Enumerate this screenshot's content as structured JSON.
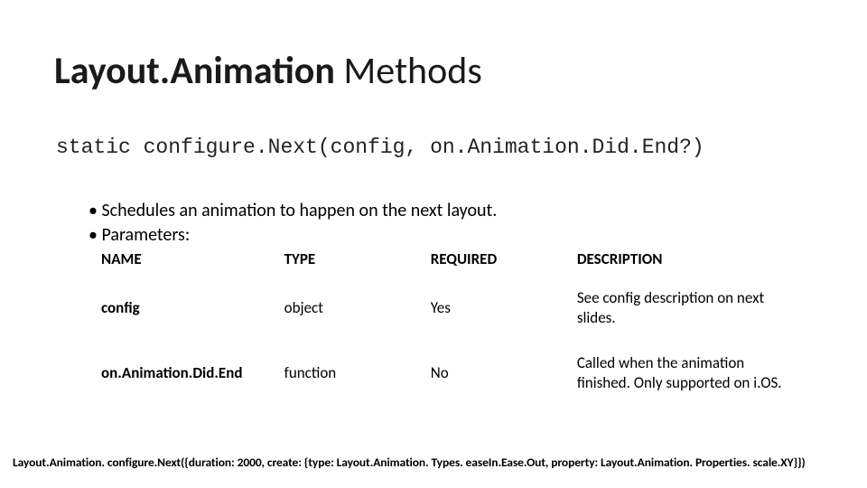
{
  "title": {
    "bold_part": "Layout.Animation",
    "light_part": " Methods"
  },
  "signature": "static configure.Next(config, on.Animation.Did.End?)",
  "bullets": [
    "Schedules an animation to happen on the next layout.",
    "Parameters:"
  ],
  "table": {
    "headers": {
      "name": "NAME",
      "type": "TYPE",
      "required": "REQUIRED",
      "description": "DESCRIPTION"
    },
    "rows": [
      {
        "name": "config",
        "type": "object",
        "required": "Yes",
        "description": "See config description on next slides."
      },
      {
        "name": "on.Animation.Did.End",
        "type": "function",
        "required": "No",
        "description": "Called when the animation finished. Only supported on i.OS."
      }
    ]
  },
  "footer_code": "Layout.Animation. configure.Next({duration: 2000, create: {type: Layout.Animation. Types. easeIn.Ease.Out, property: Layout.Animation. Properties. scale.XY}})"
}
